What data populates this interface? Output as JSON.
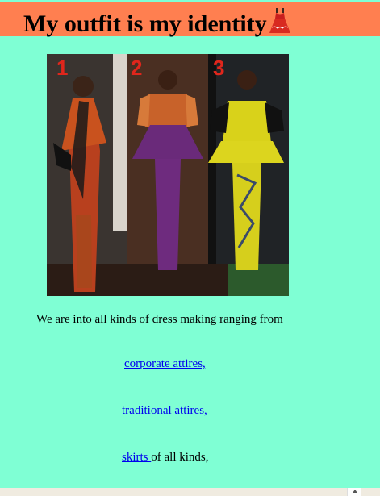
{
  "header": {
    "title": "My outfit is my identity",
    "title_icon": "dress-icon",
    "background": "#ff7f50"
  },
  "page": {
    "background": "#7fffd4"
  },
  "photo": {
    "labels": [
      "1",
      "2",
      "3"
    ]
  },
  "content": {
    "intro": "We are into all kinds of dress making ranging from",
    "link_corporate": "corporate attires,",
    "link_traditional": "traditional attires,",
    "link_skirts": "skirts ",
    "skirts_suffix": "of all kinds,"
  },
  "colors": {
    "link": "#0000ee"
  }
}
